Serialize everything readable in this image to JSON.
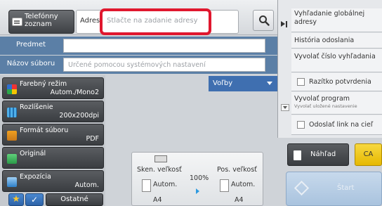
{
  "top": {
    "phonebook_label": "Telefónny zoznam",
    "address_label": "Adres",
    "address_placeholder": "Stlačte na zadanie adresy"
  },
  "fields": {
    "subject_label": "Predmet",
    "filename_label": "Názov súboru",
    "filename_placeholder": "Určené pomocou systémových nastavení"
  },
  "settings": [
    {
      "label": "Farebný režim",
      "value": "Autom./Mono2",
      "icon": "color-mode-icon"
    },
    {
      "label": "Rozlíšenie",
      "value": "200x200dpi",
      "icon": "resolution-icon"
    },
    {
      "label": "Formát súboru",
      "value": "PDF",
      "icon": "file-format-icon"
    },
    {
      "label": "Originál",
      "value": "",
      "icon": "original-icon"
    },
    {
      "label": "Expozícia",
      "value": "Autom.",
      "icon": "exposure-icon"
    }
  ],
  "options_label": "Voľby",
  "preview": {
    "scan_size_label": "Sken. veľkosť",
    "send_size_label": "Pos. veľkosť",
    "ratio": "100%",
    "scan_mode": "Autom.",
    "scan_paper": "A4",
    "send_mode": "Autom.",
    "send_paper": "A4"
  },
  "bottom": {
    "other_label": "Ostatné"
  },
  "right_panel": {
    "items": [
      {
        "label": "Vyhľadanie globálnej adresy",
        "sub": "",
        "checkbox": false
      },
      {
        "label": "História odoslania",
        "sub": "",
        "checkbox": false
      },
      {
        "label": "Vyvolať číslo vyhľadania",
        "sub": "",
        "checkbox": false
      },
      {
        "label": "Razítko potvrdenia",
        "sub": "",
        "checkbox": true
      },
      {
        "label": "Vyvolať program",
        "sub": "Vyvolať uložené nastavenie",
        "checkbox": false
      },
      {
        "label": "Odoslať link na cieľ",
        "sub": "",
        "checkbox": true
      }
    ]
  },
  "actions": {
    "preview_label": "Náhľad",
    "ca_label": "CA",
    "start_label": "Štart"
  },
  "colors": {
    "highlight_red": "#e0172e",
    "field_row_blue": "#5b7fa6",
    "options_blue": "#3f6fb0",
    "ca_yellow": "#f0c400"
  }
}
